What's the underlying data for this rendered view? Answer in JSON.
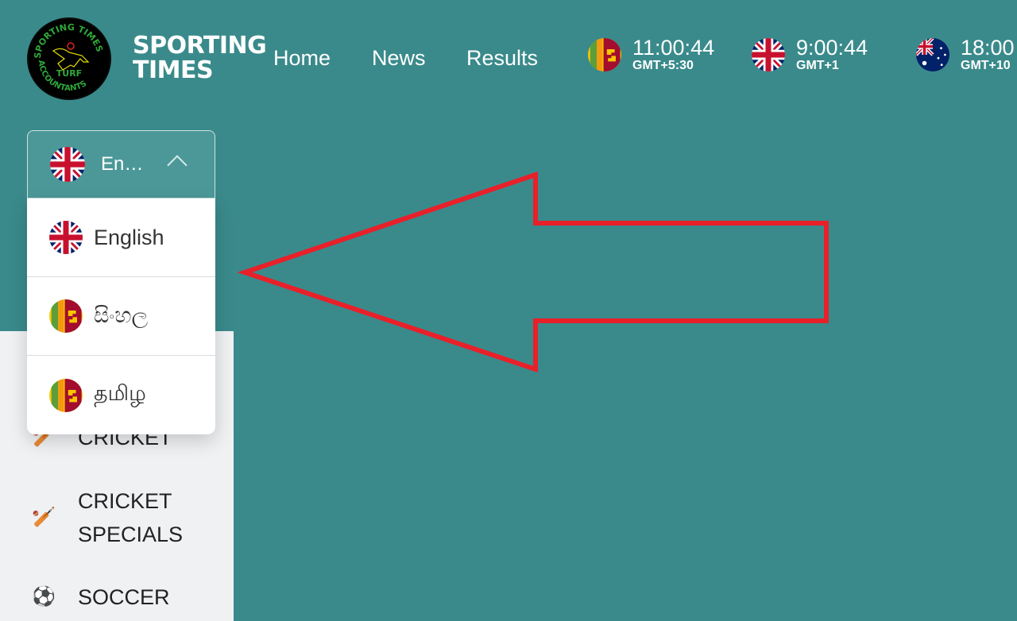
{
  "brand": {
    "name_line1": "SPORTING",
    "name_line2": "TIMES",
    "logo_text": "SPORTING TIMES TURF ACCOUNTANTS"
  },
  "nav": [
    {
      "label": "Home"
    },
    {
      "label": "News"
    },
    {
      "label": "Results"
    }
  ],
  "clocks": [
    {
      "flag": "sri-lanka",
      "time": "11:00:44",
      "tz": "GMT+5:30"
    },
    {
      "flag": "uk",
      "time": "9:00:44",
      "tz": "GMT+1"
    },
    {
      "flag": "australia",
      "time": "18:00",
      "tz": "GMT+10"
    }
  ],
  "language": {
    "selected": "En…",
    "options": [
      {
        "flag": "uk",
        "label": "English"
      },
      {
        "flag": "sri-lanka",
        "label": "සිංහල"
      },
      {
        "flag": "sri-lanka",
        "label": "தமிழ"
      }
    ]
  },
  "sidebar": {
    "items": [
      {
        "icon": "cricket-icon",
        "label": "CRICKET"
      },
      {
        "icon": "cricket-icon",
        "label": "CRICKET SPECIALS"
      },
      {
        "icon": "soccer-ball-icon",
        "label": "SOCCER"
      }
    ]
  },
  "colors": {
    "background": "#3a8a8b",
    "annotation_arrow": "#e8202a"
  }
}
